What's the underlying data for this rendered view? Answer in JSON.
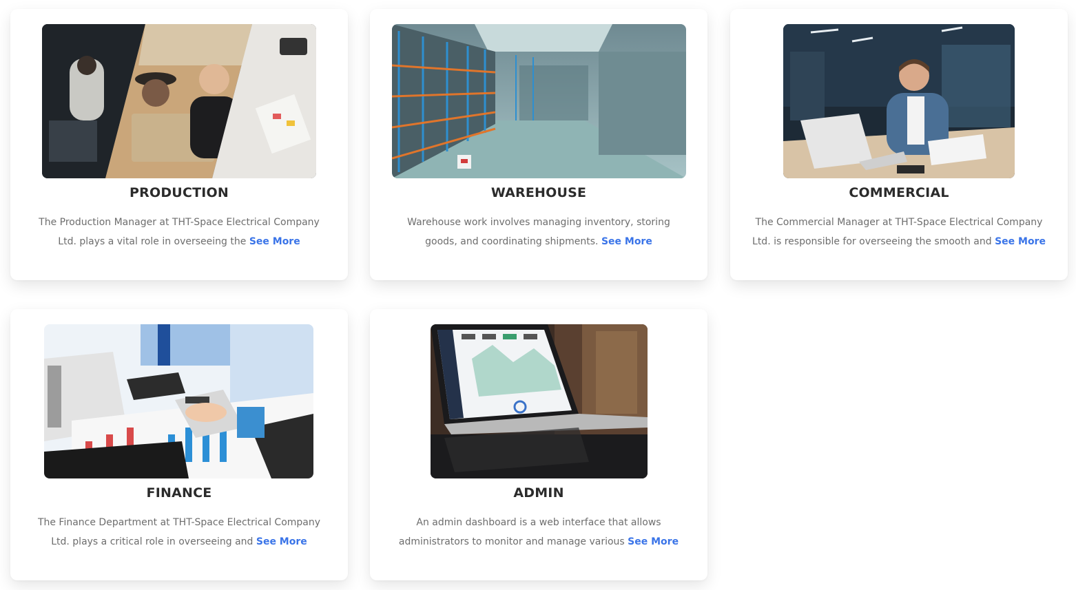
{
  "cards": [
    {
      "title": "PRODUCTION",
      "description": "The Production Manager at THT-Space Electrical Company Ltd. plays a vital role in overseeing the",
      "link": "See More",
      "image_icon": "team-collage-image"
    },
    {
      "title": "WAREHOUSE",
      "description": "Warehouse work involves managing inventory, storing goods, and coordinating shipments.",
      "link": "See More",
      "image_icon": "warehouse-image"
    },
    {
      "title": "COMMERCIAL",
      "description": "The Commercial Manager at THT-Space Electrical Company Ltd. is responsible for overseeing the smooth and",
      "link": "See More",
      "image_icon": "laptop-office-image"
    },
    {
      "title": "FINANCE",
      "description": "The Finance Department at THT-Space Electrical Company Ltd. plays a critical role in overseeing and",
      "link": "See More",
      "image_icon": "finance-charts-image"
    },
    {
      "title": "ADMIN",
      "description": "An admin dashboard is a web interface that allows administrators to monitor and manage various",
      "link": "See More",
      "image_icon": "dashboard-laptop-image"
    }
  ],
  "colors": {
    "title": "#2b2b2b",
    "text": "#6d6d6d",
    "link": "#3a74e8"
  }
}
